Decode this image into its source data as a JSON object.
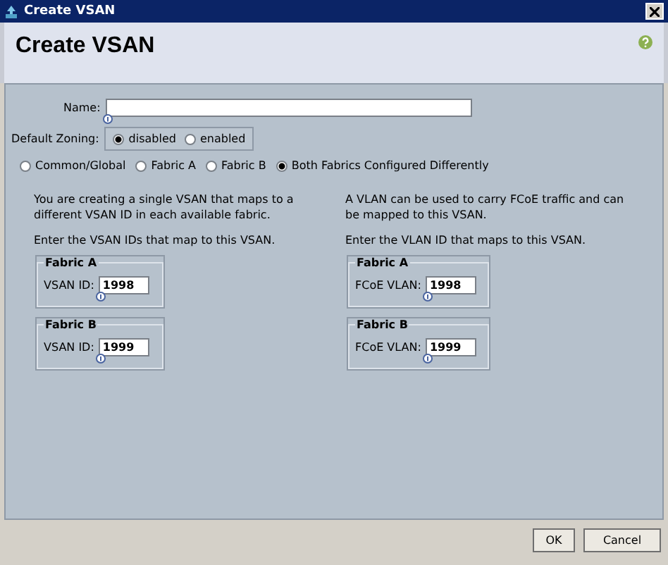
{
  "window": {
    "title": "Create VSAN"
  },
  "header": {
    "title": "Create VSAN"
  },
  "name_field": {
    "label": "Name:"
  },
  "default_zoning": {
    "label": "Default Zoning:",
    "options": [
      {
        "label": "disabled",
        "selected": true
      },
      {
        "label": "enabled",
        "selected": false
      }
    ]
  },
  "scope_options": [
    {
      "label": "Common/Global",
      "selected": false
    },
    {
      "label": "Fabric A",
      "selected": false
    },
    {
      "label": "Fabric B",
      "selected": false
    },
    {
      "label": "Both Fabrics Configured Differently",
      "selected": true
    }
  ],
  "columns": [
    {
      "intro": "You are creating a single VSAN that maps to a different VSAN ID in each available fabric.",
      "instruction": "Enter the VSAN IDs that map to this VSAN.",
      "groups": [
        {
          "title": "Fabric A",
          "field_label": "VSAN ID:",
          "value": "1998"
        },
        {
          "title": "Fabric B",
          "field_label": "VSAN ID:",
          "value": "1999"
        }
      ]
    },
    {
      "intro": "A VLAN can be used to carry FCoE traffic and can be mapped to this VSAN.",
      "instruction": "Enter the VLAN ID that maps to this VSAN.",
      "groups": [
        {
          "title": "Fabric A",
          "field_label": "FCoE VLAN:",
          "value": "1998"
        },
        {
          "title": "Fabric B",
          "field_label": "FCoE VLAN:",
          "value": "1999"
        }
      ]
    }
  ],
  "buttons": [
    "OK",
    "Cancel"
  ]
}
